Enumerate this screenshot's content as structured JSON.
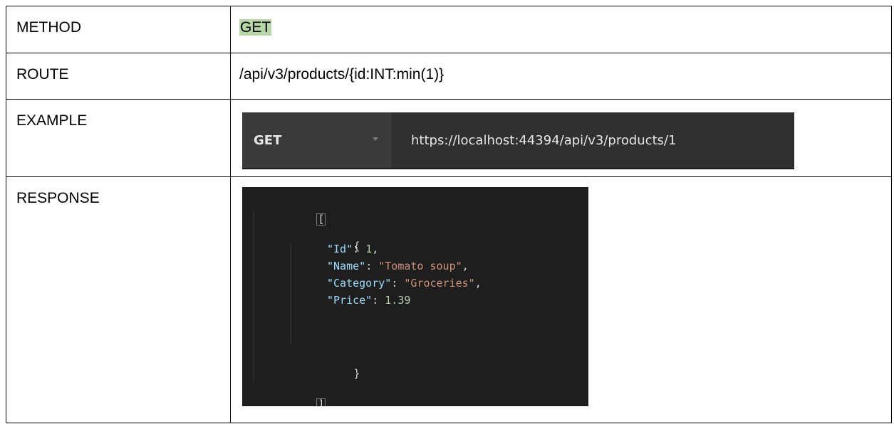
{
  "rows": {
    "method": {
      "label": "METHOD",
      "value": "GET",
      "highlight_color": "#b7d7a8"
    },
    "route": {
      "label": "ROUTE",
      "value": "/api/v3/products/{id:INT:min(1)}"
    },
    "example": {
      "label": "EXAMPLE",
      "request_method": "GET",
      "request_url": "https://localhost:44394/api/v3/products/1",
      "dropdown_icon": "chevron-down-icon"
    },
    "response": {
      "label": "RESPONSE",
      "open_bracket": "[",
      "close_bracket": "]",
      "open_brace": "{",
      "close_brace": "}",
      "fields": [
        {
          "key": "\"Id\"",
          "value": "1",
          "type": "number",
          "trailing": ","
        },
        {
          "key": "\"Name\"",
          "value": "\"Tomato soup\"",
          "type": "string",
          "trailing": ","
        },
        {
          "key": "\"Category\"",
          "value": "\"Groceries\"",
          "type": "string",
          "trailing": ","
        },
        {
          "key": "\"Price\"",
          "value": "1.39",
          "type": "number",
          "trailing": ""
        }
      ]
    }
  },
  "colors": {
    "code_background": "#1e1e1e",
    "json_key": "#9cdcfe",
    "json_string": "#ce9178",
    "json_number": "#b5cea8",
    "request_bar_background": "#303030"
  }
}
